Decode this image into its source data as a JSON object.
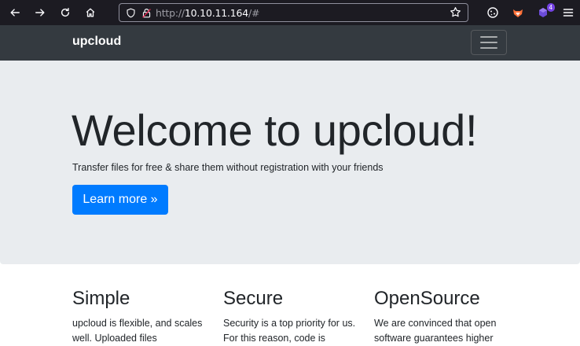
{
  "browser": {
    "url_scheme": "http://",
    "url_host": "10.10.11.164",
    "url_hash": "/#",
    "extension_badge": "4",
    "icons": [
      "back-icon",
      "forward-icon",
      "reload-icon",
      "home-icon",
      "shield-icon",
      "lock-insecure-icon",
      "star-icon",
      "cookie-icon",
      "fox-icon",
      "extension-icon",
      "menu-icon"
    ]
  },
  "navbar": {
    "brand": "upcloud"
  },
  "hero": {
    "title": "Welcome to upcloud!",
    "subtitle": "Transfer files for free & share them without registration with your friends",
    "button_label": "Learn more »"
  },
  "features": [
    {
      "title": "Simple",
      "text": "upcloud is flexible, and scales well. Uploaded files"
    },
    {
      "title": "Secure",
      "text": "Security is a top priority for us. For this reason, code is"
    },
    {
      "title": "OpenSource",
      "text": "We are convinced that open software guarantees higher"
    }
  ],
  "colors": {
    "browser_bg": "#1c1b22",
    "navbar_bg": "#343a40",
    "hero_bg": "#e9ecef",
    "primary": "#007bff",
    "text": "#212529"
  }
}
